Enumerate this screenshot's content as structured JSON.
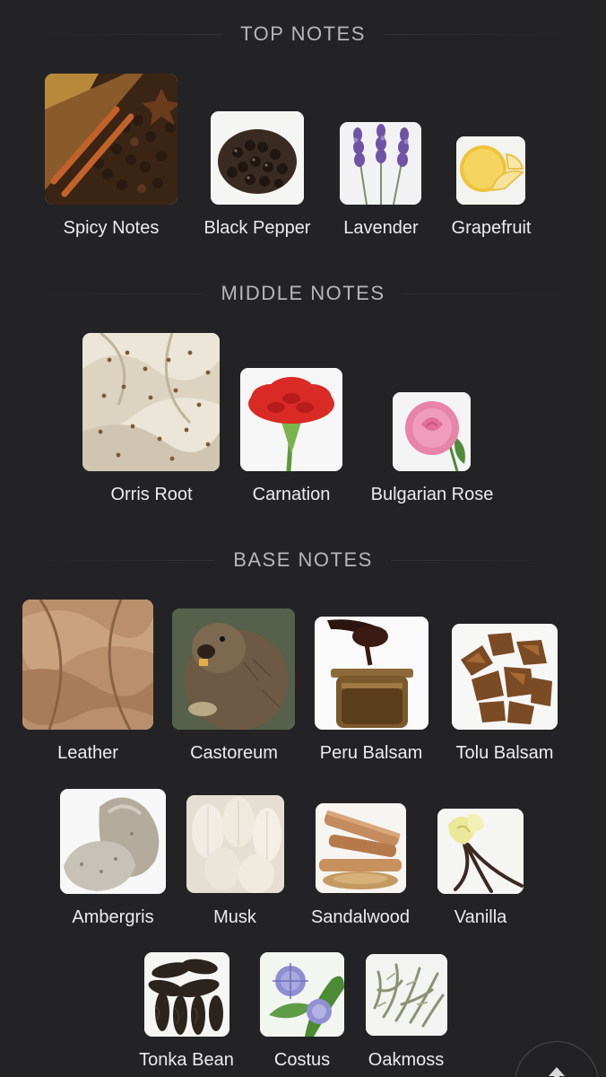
{
  "sections": {
    "top": {
      "title": "TOP NOTES",
      "notes": [
        {
          "name": "Spicy Notes",
          "icon": "spicy-notes-photo"
        },
        {
          "name": "Black Pepper",
          "icon": "black-pepper-photo"
        },
        {
          "name": "Lavender",
          "icon": "lavender-photo"
        },
        {
          "name": "Grapefruit",
          "icon": "grapefruit-photo"
        }
      ]
    },
    "middle": {
      "title": "MIDDLE NOTES",
      "notes": [
        {
          "name": "Orris Root",
          "icon": "orris-root-photo"
        },
        {
          "name": "Carnation",
          "icon": "carnation-photo"
        },
        {
          "name": "Bulgarian Rose",
          "icon": "bulgarian-rose-photo"
        }
      ]
    },
    "base": {
      "title": "BASE NOTES",
      "notes": [
        {
          "name": "Leather",
          "icon": "leather-photo"
        },
        {
          "name": "Castoreum",
          "icon": "castoreum-photo"
        },
        {
          "name": "Peru Balsam",
          "icon": "peru-balsam-photo"
        },
        {
          "name": "Tolu Balsam",
          "icon": "tolu-balsam-photo"
        },
        {
          "name": "Ambergris",
          "icon": "ambergris-photo"
        },
        {
          "name": "Musk",
          "icon": "musk-photo"
        },
        {
          "name": "Sandalwood",
          "icon": "sandalwood-photo"
        },
        {
          "name": "Vanilla",
          "icon": "vanilla-photo"
        },
        {
          "name": "Tonka Bean",
          "icon": "tonka-bean-photo"
        },
        {
          "name": "Costus",
          "icon": "costus-photo"
        },
        {
          "name": "Oakmoss",
          "icon": "oakmoss-photo"
        }
      ]
    }
  },
  "scroll_top_icon": "arrow-up-icon",
  "colors": {
    "background": "#232326",
    "header_text": "#b7b7bb",
    "label_text": "#ececee"
  }
}
